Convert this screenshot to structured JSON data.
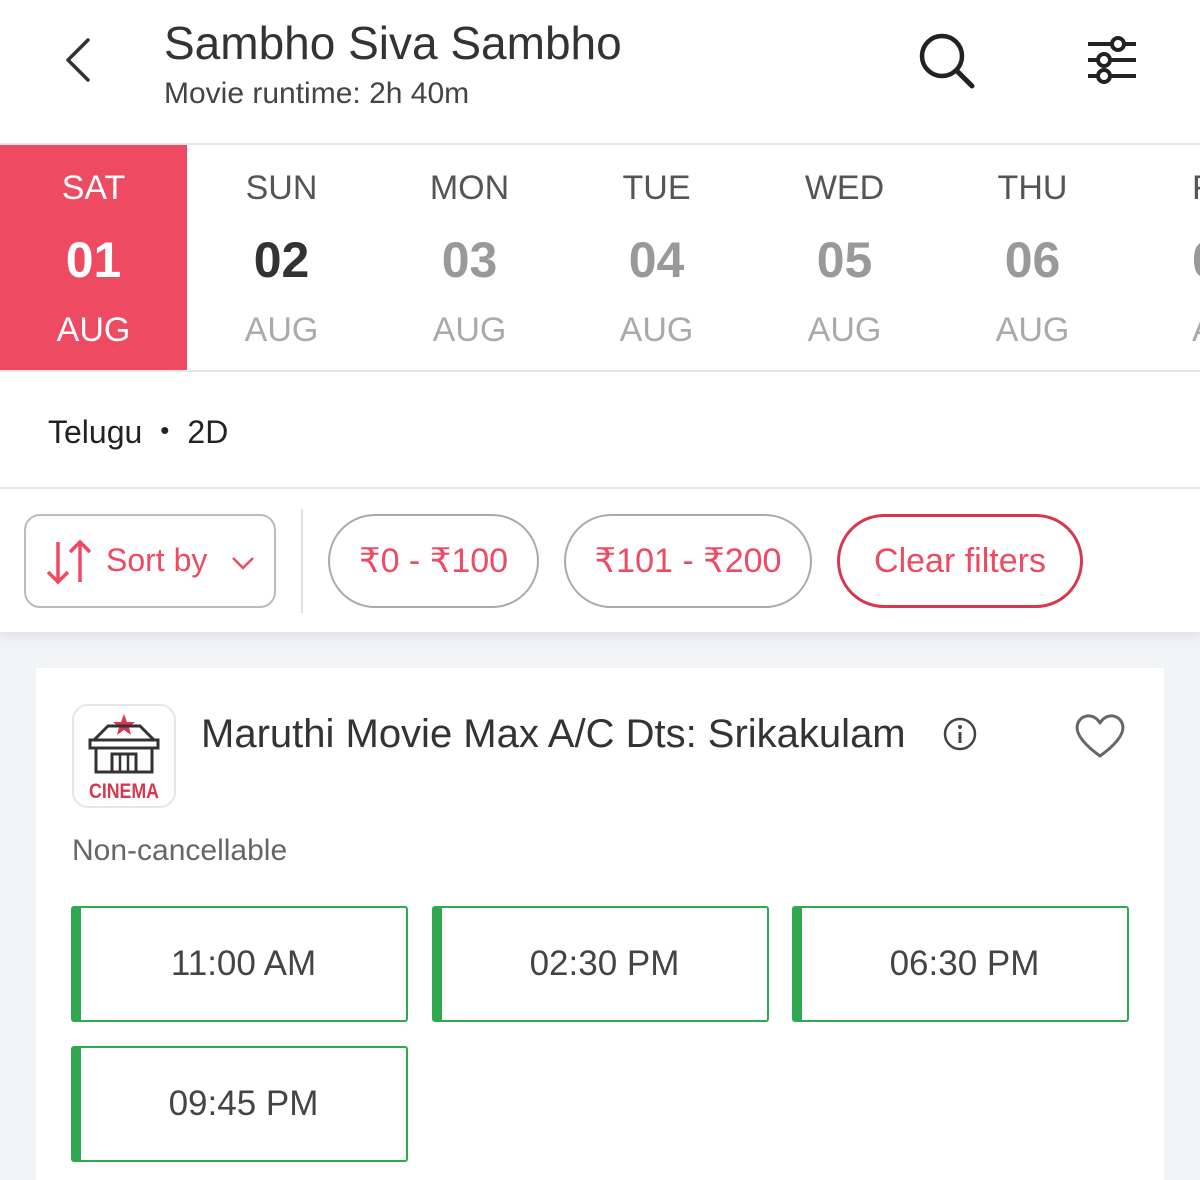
{
  "header": {
    "title": "Sambho Siva Sambho",
    "subtitle": "Movie runtime: 2h 40m",
    "back_icon": "chevron-left-icon",
    "search_icon": "search-icon",
    "filter_icon": "sliders-icon"
  },
  "dates": [
    {
      "dow": "SAT",
      "day": "01",
      "month": "AUG",
      "selected": true
    },
    {
      "dow": "SUN",
      "day": "02",
      "month": "AUG"
    },
    {
      "dow": "MON",
      "day": "03",
      "month": "AUG"
    },
    {
      "dow": "TUE",
      "day": "04",
      "month": "AUG"
    },
    {
      "dow": "WED",
      "day": "05",
      "month": "AUG"
    },
    {
      "dow": "THU",
      "day": "06",
      "month": "AUG"
    },
    {
      "dow": "F",
      "day": "0",
      "month": "A"
    }
  ],
  "format": {
    "language": "Telugu",
    "separator": "•",
    "dimension": "2D"
  },
  "filters": {
    "sort_label": "Sort by",
    "chips": [
      "₹0 - ₹100",
      "₹101 - ₹200"
    ],
    "clear_label": "Clear filters"
  },
  "cinema": {
    "logo_text": "CINEMA",
    "name": "Maruthi Movie Max A/C Dts: Srikakulam",
    "policy": "Non-cancellable",
    "showtimes": [
      "11:00 AM",
      "02:30 PM",
      "06:30 PM",
      "09:45 PM"
    ]
  },
  "colors": {
    "accent": "#ee4a62",
    "available": "#2fa84f"
  }
}
